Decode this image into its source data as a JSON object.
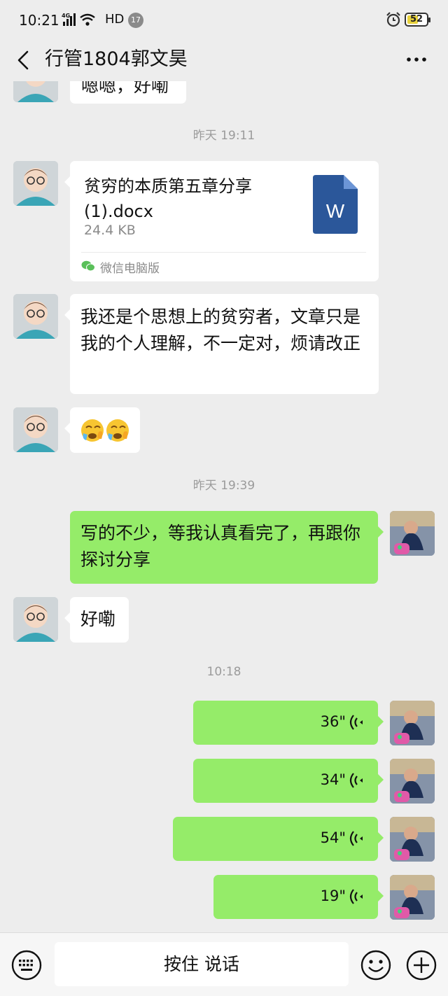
{
  "status_bar": {
    "time": "10:21",
    "network": "4G",
    "hd": "HD",
    "notification_count": "17",
    "battery": "52"
  },
  "header": {
    "title": "行管1804郭文昊"
  },
  "messages": {
    "partial_top": "嗯嗯，好嘞",
    "ts1": "昨天 19:11",
    "file": {
      "name": "贫穷的本质第五章分享(1).docx",
      "size": "24.4 KB",
      "source": "微信电脑版",
      "icon_letter": "W"
    },
    "text1": "我还是个思想上的贫穷者，文章只是我的个人理解，不一定对，烦请改正",
    "ts2": "昨天 19:39",
    "text2": "写的不少，等我认真看完了，再跟你探讨分享",
    "text3": "好嘞",
    "ts3": "10:18",
    "voices": [
      "36\"",
      "34\"",
      "54\"",
      "19\""
    ]
  },
  "input_bar": {
    "hold_to_talk": "按住 说话"
  },
  "colors": {
    "background": "#ededed",
    "self_bubble": "#95ec69",
    "other_bubble": "#ffffff",
    "word_icon": "#2b579a"
  }
}
